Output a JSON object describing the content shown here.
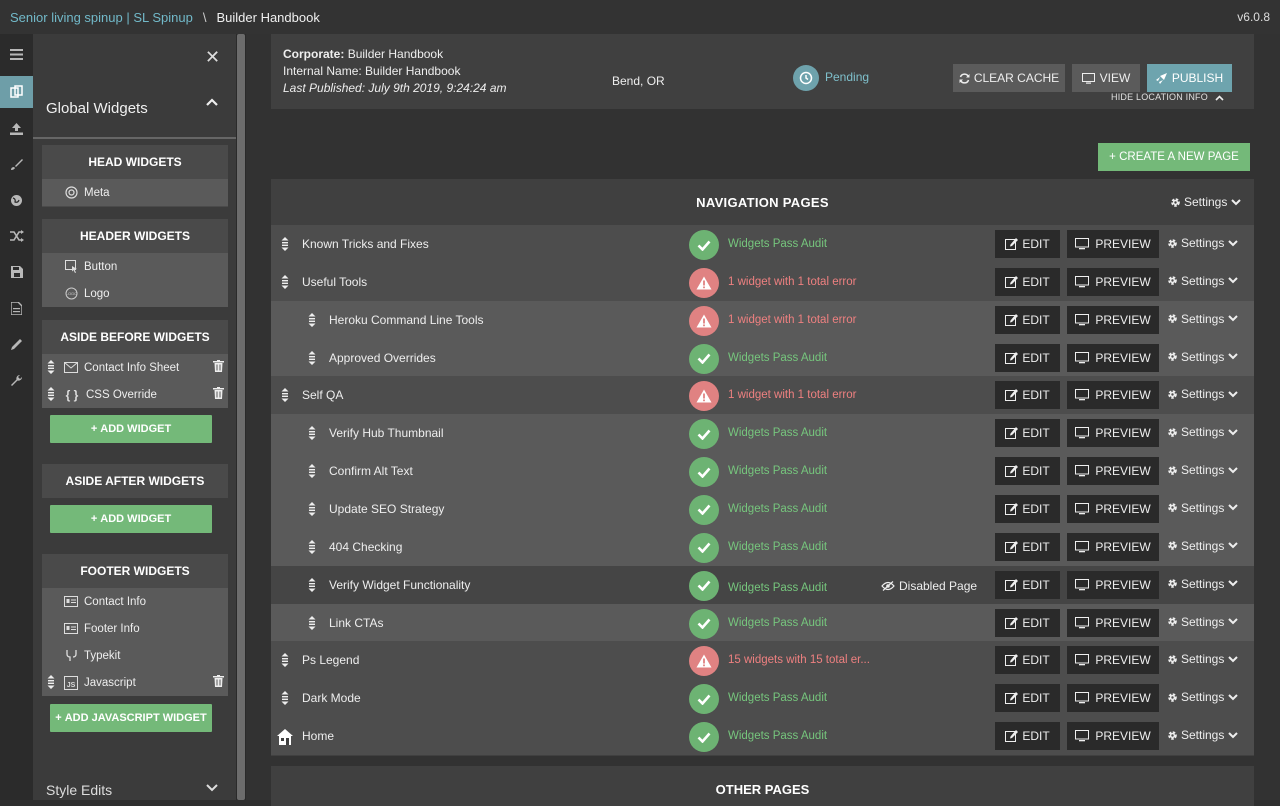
{
  "topbar": {
    "crumb_parent": "Senior living spinup | SL Spinup",
    "separator": "\\",
    "crumb_current": "Builder Handbook",
    "version": "v6.0.8"
  },
  "sidebar": {
    "title": "Global Widgets",
    "sections": {
      "head": {
        "title": "HEAD WIDGETS",
        "items": [
          "Meta"
        ]
      },
      "header": {
        "title": "HEADER WIDGETS",
        "items": [
          "Button",
          "Logo"
        ]
      },
      "aside_before": {
        "title": "ASIDE BEFORE WIDGETS",
        "items": [
          "Contact Info Sheet",
          "CSS Override"
        ],
        "add_label": "ADD WIDGET"
      },
      "aside_after": {
        "title": "ASIDE AFTER WIDGETS",
        "add_label": "ADD WIDGET"
      },
      "footer": {
        "title": "FOOTER WIDGETS",
        "items": [
          "Contact Info",
          "Footer Info",
          "Typekit",
          "Javascript"
        ],
        "add_label": "ADD JAVASCRIPT WIDGET"
      }
    },
    "style_edits": "Style Edits"
  },
  "location": {
    "corporate_label": "Corporate:",
    "corporate_value": "Builder Handbook",
    "internal_label": "Internal Name:",
    "internal_value": "Builder Handbook",
    "published": "Last Published: July 9th 2019, 9:24:24 am",
    "city": "Bend, OR",
    "status": "Pending",
    "buttons": {
      "clear_cache": "CLEAR CACHE",
      "view": "VIEW",
      "publish": "PUBLISH"
    },
    "hide_info": "HIDE LOCATION INFO"
  },
  "create_page": "CREATE A NEW PAGE",
  "nav": {
    "title": "NAVIGATION PAGES",
    "settings": "Settings",
    "edit_label": "EDIT",
    "preview_label": "PREVIEW",
    "disabled_label": "Disabled Page",
    "rows": [
      {
        "name": "Known Tricks and Fixes",
        "level": 0,
        "status": "ok",
        "status_text": "Widgets Pass Audit"
      },
      {
        "name": "Useful Tools",
        "level": 0,
        "status": "err",
        "status_text": "1 widget with 1 total error"
      },
      {
        "name": "Heroku Command Line Tools",
        "level": 1,
        "status": "err",
        "status_text": "1 widget with 1 total error"
      },
      {
        "name": "Approved Overrides",
        "level": 1,
        "status": "ok",
        "status_text": "Widgets Pass Audit"
      },
      {
        "name": "Self QA",
        "level": 0,
        "status": "err",
        "status_text": "1 widget with 1 total error"
      },
      {
        "name": "Verify Hub Thumbnail",
        "level": 1,
        "status": "ok",
        "status_text": "Widgets Pass Audit"
      },
      {
        "name": "Confirm Alt Text",
        "level": 1,
        "status": "ok",
        "status_text": "Widgets Pass Audit"
      },
      {
        "name": "Update SEO Strategy",
        "level": 1,
        "status": "ok",
        "status_text": "Widgets Pass Audit"
      },
      {
        "name": "404 Checking",
        "level": 1,
        "status": "ok",
        "status_text": "Widgets Pass Audit"
      },
      {
        "name": "Verify Widget Functionality",
        "level": 1,
        "status": "ok",
        "status_text": "Widgets Pass Audit",
        "disabled": true
      },
      {
        "name": "Link CTAs",
        "level": 1,
        "status": "ok",
        "status_text": "Widgets Pass Audit"
      },
      {
        "name": "Ps Legend",
        "level": 0,
        "status": "err",
        "status_text": "15 widgets with 15 total er..."
      },
      {
        "name": "Dark Mode",
        "level": 0,
        "status": "ok",
        "status_text": "Widgets Pass Audit"
      },
      {
        "name": "Home",
        "level": 0,
        "status": "ok",
        "status_text": "Widgets Pass Audit",
        "home": true
      }
    ]
  },
  "other": {
    "title": "OTHER PAGES"
  },
  "colors": {
    "accent": "#6ea4ae",
    "success": "#74b979",
    "error": "#e08282"
  }
}
